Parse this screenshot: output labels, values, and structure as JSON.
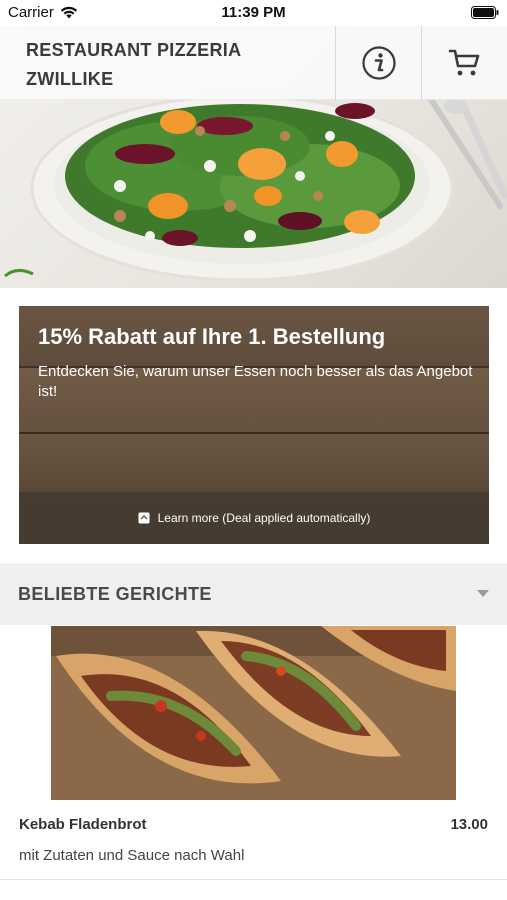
{
  "status_bar": {
    "carrier": "Carrier",
    "time": "11:39 PM"
  },
  "header": {
    "title_line1": "RESTAURANT PIZZERIA",
    "title_line2": "ZWILLIKE",
    "info_icon": "info-icon",
    "cart_icon": "cart-icon"
  },
  "promo": {
    "title": "15% Rabatt auf Ihre 1. Bestellung",
    "text": "Entdecken Sie, warum unser Essen noch besser als das Angebot ist!",
    "footer": "Learn more (Deal applied automatically)"
  },
  "section": {
    "title": "BELIEBTE GERICHTE"
  },
  "dishes": [
    {
      "name": "Kebab Fladenbrot",
      "price": "13.00",
      "description": "mit Zutaten und Sauce nach Wahl"
    }
  ],
  "colors": {
    "header_bg": "#fafafa",
    "section_bg": "#efefef",
    "promo_wood": "#5d4b3a",
    "text_dark": "#333333"
  }
}
